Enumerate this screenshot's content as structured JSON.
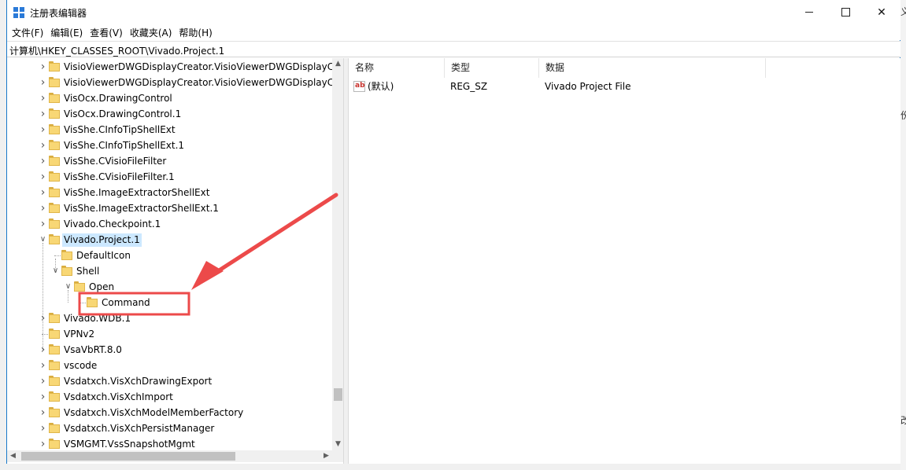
{
  "window": {
    "title": "注册表编辑器",
    "controls": {
      "minimize": "minimize",
      "maximize": "maximize",
      "close": "✕"
    }
  },
  "menu": [
    "文件(F)",
    "编辑(E)",
    "查看(V)",
    "收藏夹(A)",
    "帮助(H)"
  ],
  "address": "计算机\\HKEY_CLASSES_ROOT\\Vivado.Project.1",
  "tree": {
    "items": [
      {
        "label": "VisioViewerDWGDisplayCreator.VisioViewerDWGDisplayCr",
        "level": 0,
        "state": "collapsed"
      },
      {
        "label": "VisioViewerDWGDisplayCreator.VisioViewerDWGDisplayCr",
        "level": 0,
        "state": "collapsed"
      },
      {
        "label": "VisOcx.DrawingControl",
        "level": 0,
        "state": "collapsed"
      },
      {
        "label": "VisOcx.DrawingControl.1",
        "level": 0,
        "state": "collapsed"
      },
      {
        "label": "VisShe.CInfoTipShellExt",
        "level": 0,
        "state": "collapsed"
      },
      {
        "label": "VisShe.CInfoTipShellExt.1",
        "level": 0,
        "state": "collapsed"
      },
      {
        "label": "VisShe.CVisioFileFilter",
        "level": 0,
        "state": "collapsed"
      },
      {
        "label": "VisShe.CVisioFileFilter.1",
        "level": 0,
        "state": "collapsed"
      },
      {
        "label": "VisShe.ImageExtractorShellExt",
        "level": 0,
        "state": "collapsed"
      },
      {
        "label": "VisShe.ImageExtractorShellExt.1",
        "level": 0,
        "state": "collapsed"
      },
      {
        "label": "Vivado.Checkpoint.1",
        "level": 0,
        "state": "collapsed"
      },
      {
        "label": "Vivado.Project.1",
        "level": 0,
        "state": "expanded",
        "selected": true
      },
      {
        "label": "DefaultIcon",
        "level": 1,
        "state": "leaf"
      },
      {
        "label": "Shell",
        "level": 1,
        "state": "expanded"
      },
      {
        "label": "Open",
        "level": 2,
        "state": "expanded"
      },
      {
        "label": "Command",
        "level": 3,
        "state": "leaf",
        "highlighted": true
      },
      {
        "label": "Vivado.WDB.1",
        "level": 0,
        "state": "collapsed"
      },
      {
        "label": "VPNv2",
        "level": 0,
        "state": "leaf"
      },
      {
        "label": "VsaVbRT.8.0",
        "level": 0,
        "state": "collapsed"
      },
      {
        "label": "vscode",
        "level": 0,
        "state": "collapsed"
      },
      {
        "label": "Vsdatxch.VisXchDrawingExport",
        "level": 0,
        "state": "collapsed"
      },
      {
        "label": "Vsdatxch.VisXchImport",
        "level": 0,
        "state": "collapsed"
      },
      {
        "label": "Vsdatxch.VisXchModelMemberFactory",
        "level": 0,
        "state": "collapsed"
      },
      {
        "label": "Vsdatxch.VisXchPersistManager",
        "level": 0,
        "state": "collapsed"
      },
      {
        "label": "VSMGMT.VssSnapshotMgmt",
        "level": 0,
        "state": "collapsed"
      }
    ]
  },
  "list": {
    "columns": [
      "名称",
      "类型",
      "数据"
    ],
    "rows": [
      {
        "name": "(默认)",
        "type": "REG_SZ",
        "data": "Vivado Project File",
        "icon": "ab"
      }
    ]
  },
  "annotation": {
    "color": "#ec4a4a",
    "target": "Command"
  },
  "background_fragments": [
    "义",
    "份",
    "改"
  ]
}
